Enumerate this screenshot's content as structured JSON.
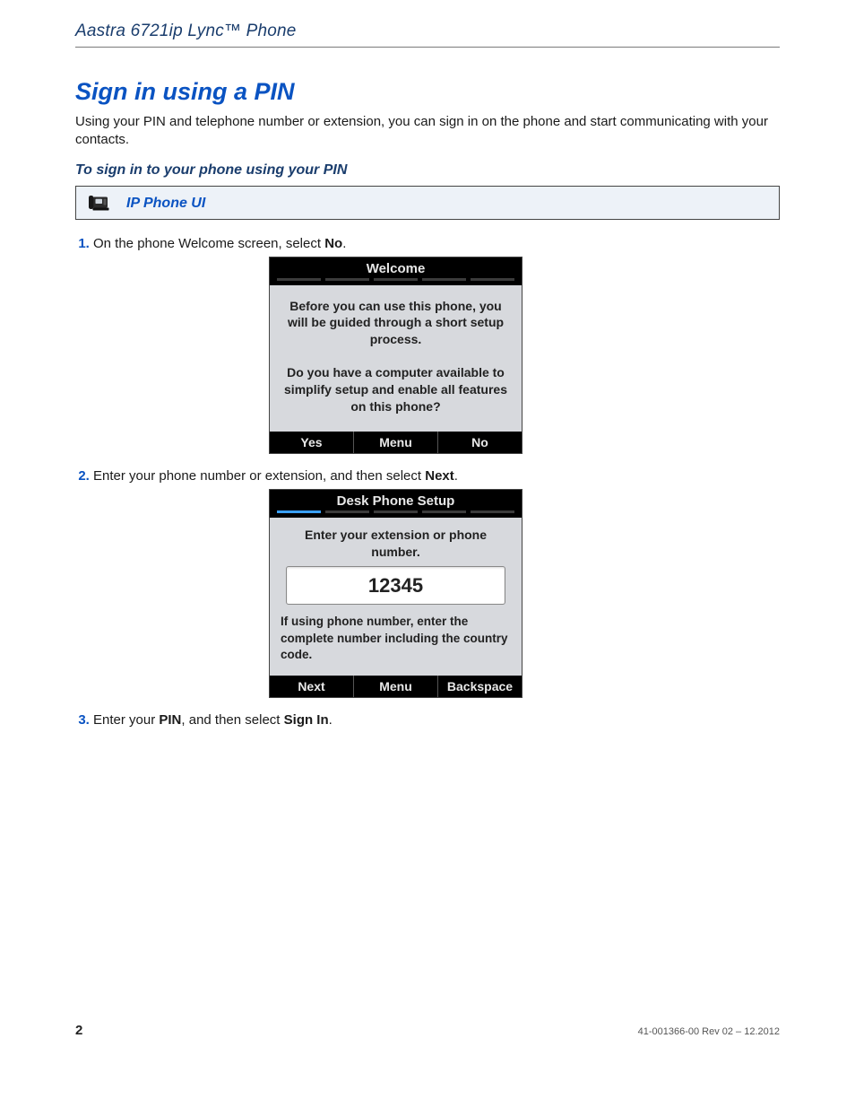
{
  "header": {
    "running_head": "Aastra 6721ip Lync™ Phone"
  },
  "title": "Sign in using a PIN",
  "intro": "Using your PIN and telephone number or extension, you can sign in on the phone and start communicating with your contacts.",
  "subhead": "To sign in to your phone using your PIN",
  "callout": {
    "label": "IP Phone UI"
  },
  "steps": {
    "s1": {
      "pre": "On the phone Welcome screen, select ",
      "bold": "No",
      "post": "."
    },
    "s2": {
      "pre": "Enter your phone number or extension, and then select ",
      "bold": "Next",
      "post": "."
    },
    "s3": {
      "pre1": "Enter your ",
      "bold1": "PIN",
      "mid": ", and then select ",
      "bold2": "Sign In",
      "post": "."
    }
  },
  "screen1": {
    "title": "Welcome",
    "line1": "Before you can use this phone, you will be guided through a short setup process.",
    "line2": "Do you have a computer available to simplify setup and enable all features on this phone?",
    "keys": {
      "left": "Yes",
      "mid": "Menu",
      "right": "No"
    }
  },
  "screen2": {
    "title": "Desk Phone Setup",
    "caption": "Enter your extension or phone number.",
    "value": "12345",
    "hint": "If using phone number, enter the complete number including the country code.",
    "keys": {
      "left": "Next",
      "mid": "Menu",
      "right": "Backspace"
    }
  },
  "footer": {
    "page": "2",
    "rev": "41-001366-00 Rev 02 – 12.2012"
  }
}
